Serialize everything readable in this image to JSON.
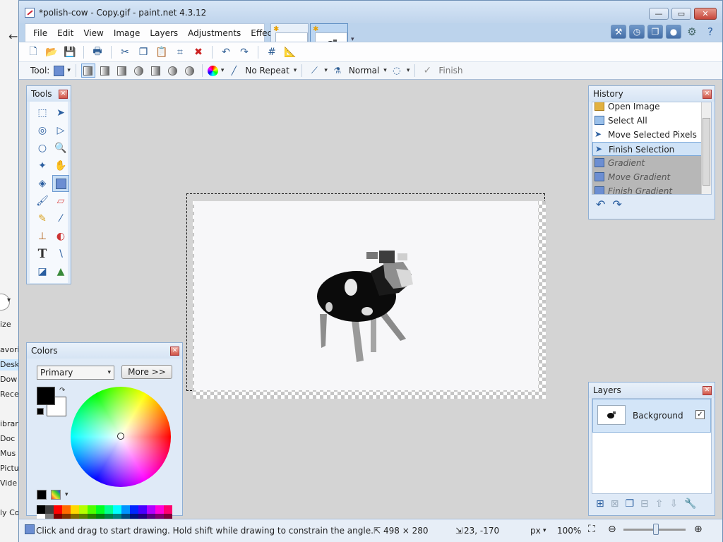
{
  "window": {
    "title": "*polish-cow - Copy.gif - paint.net 4.3.12",
    "minimize": "—",
    "maximize": "▭",
    "close": "✕"
  },
  "menu": [
    "File",
    "Edit",
    "View",
    "Image",
    "Layers",
    "Adjustments",
    "Effects"
  ],
  "toolbar": {
    "tool_label": "Tool:",
    "repeat_mode": "No Repeat",
    "blend_mode": "Normal",
    "finish_label": "Finish"
  },
  "tools_panel": {
    "title": "Tools"
  },
  "history_panel": {
    "title": "History",
    "items": [
      {
        "label": "Open Image",
        "state": "done",
        "icon": "folder-icon"
      },
      {
        "label": "Select All",
        "state": "done",
        "icon": "select-all-icon"
      },
      {
        "label": "Move Selected Pixels",
        "state": "done",
        "icon": "move-pixels-icon"
      },
      {
        "label": "Finish Selection",
        "state": "selected",
        "icon": "finish-selection-icon"
      },
      {
        "label": "Gradient",
        "state": "undone",
        "icon": "gradient-icon"
      },
      {
        "label": "Move Gradient",
        "state": "undone",
        "icon": "gradient-icon"
      },
      {
        "label": "Finish Gradient",
        "state": "undone",
        "icon": "gradient-icon"
      }
    ]
  },
  "colors_panel": {
    "title": "Colors",
    "mode": "Primary",
    "more_label": "More >>",
    "primary_color": "#000000",
    "secondary_color": "#ffffff"
  },
  "layers_panel": {
    "title": "Layers",
    "layers": [
      {
        "name": "Background",
        "visible": true
      }
    ]
  },
  "status": {
    "hint": "Click and drag to start drawing. Hold shift while drawing to constrain the angle.",
    "selection_size": "498 × 280",
    "cursor_pos": "23, -170",
    "units": "px",
    "zoom": "100%"
  },
  "background_app": {
    "nav_items": [
      "avori",
      "Desk",
      "Dow",
      "Rece",
      "ibrari",
      "Doc",
      "Mus",
      "Pictu",
      "Vide",
      "ly Co"
    ],
    "search_label": "ize"
  }
}
